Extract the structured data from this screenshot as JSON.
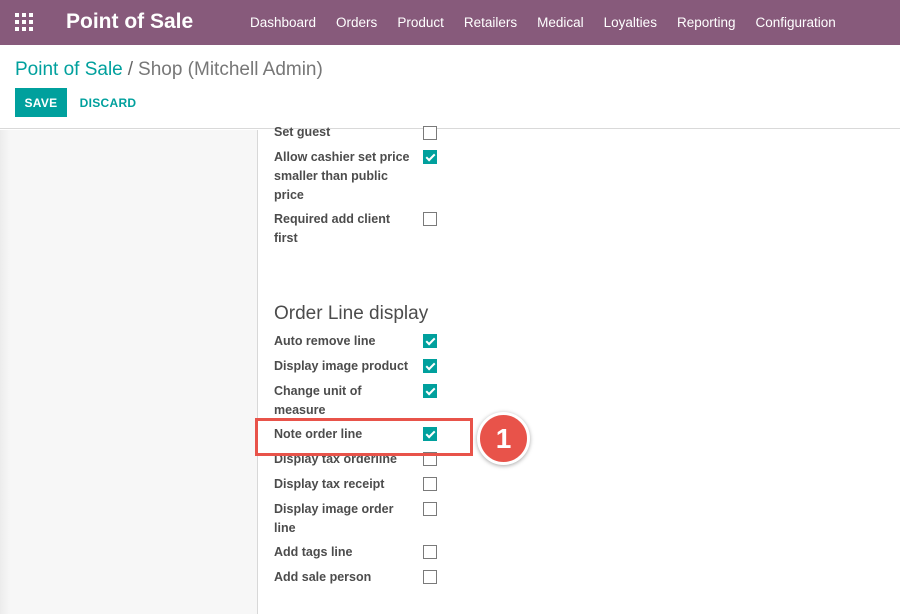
{
  "app": {
    "brand": "Point of Sale",
    "apps_icon": "apps-grid-icon",
    "menu": [
      "Dashboard",
      "Orders",
      "Product",
      "Retailers",
      "Medical",
      "Loyalties",
      "Reporting",
      "Configuration"
    ]
  },
  "breadcrumb": {
    "parent": "Point of Sale",
    "separator": "/",
    "current": "Shop (Mitchell Admin)"
  },
  "actions": {
    "save_label": "SAVE",
    "discard_label": "DISCARD"
  },
  "settings_top": [
    {
      "label": "Set guest",
      "checked": false
    },
    {
      "label": "Allow cashier set price smaller than public price",
      "checked": true
    },
    {
      "label": "Required add client first",
      "checked": false
    }
  ],
  "order_line_display": {
    "title": "Order Line display",
    "fields": [
      {
        "label": "Auto remove line",
        "checked": true
      },
      {
        "label": "Display image product",
        "checked": true
      },
      {
        "label": "Change unit of measure",
        "checked": true
      },
      {
        "label": "Note order line",
        "checked": true
      },
      {
        "label": "Display tax orderline",
        "checked": false
      },
      {
        "label": "Display tax receipt",
        "checked": false
      },
      {
        "label": "Display image order line",
        "checked": false
      },
      {
        "label": "Add tags line",
        "checked": false
      },
      {
        "label": "Add sale person",
        "checked": false
      }
    ]
  },
  "annotation": {
    "callout_number": "1",
    "color": "#e8534a"
  },
  "colors": {
    "navbar": "#875a7b",
    "accent": "#00a09d"
  }
}
